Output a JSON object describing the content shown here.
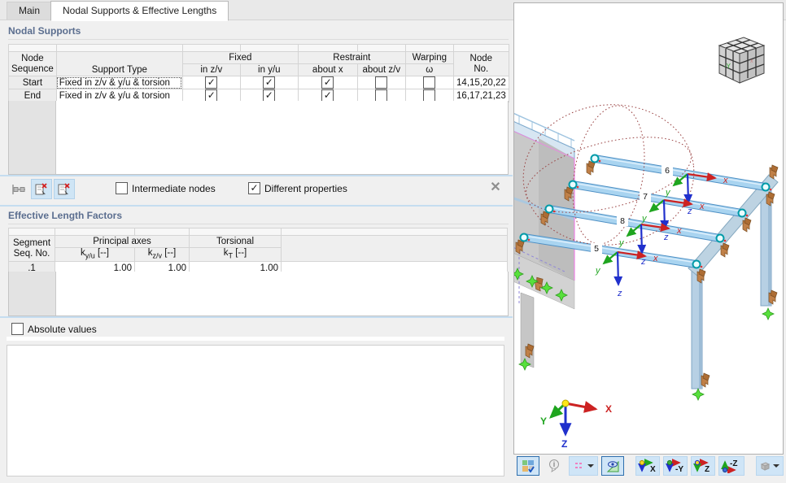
{
  "tabs": {
    "main": "Main",
    "active": "Nodal Supports & Effective Lengths"
  },
  "nodal_supports": {
    "title": "Nodal Supports",
    "col_headers": {
      "node_sequence_l1": "Node",
      "node_sequence_l2": "Sequence",
      "support_type": "Support Type",
      "fixed": "Fixed",
      "in_zv": "in z/v",
      "in_yu": "in y/u",
      "restraint": "Restraint",
      "about_x": "about x",
      "about_zv": "about z/v",
      "warping": "Warping",
      "omega": "ω",
      "node_l1": "Node",
      "node_l2": "No."
    },
    "rows": [
      {
        "seq": "Start",
        "type": "Fixed in z/v & y/u & torsion",
        "in_zv": "✓",
        "in_yu": "✓",
        "about_x": "✓",
        "about_zv": "",
        "omega": "",
        "nodes": "14,15,20,22"
      },
      {
        "seq": "End",
        "type": "Fixed in z/v & y/u & torsion",
        "in_zv": "✓",
        "in_yu": "✓",
        "about_x": "✓",
        "about_zv": "",
        "omega": "",
        "nodes": "16,17,21,23"
      }
    ],
    "intermediate_nodes_label": "Intermediate nodes",
    "intermediate_nodes_check": "",
    "different_properties_label": "Different properties",
    "different_properties_check": "✓",
    "close_x": "✕"
  },
  "effective_lengths": {
    "title": "Effective Length Factors",
    "col_headers": {
      "segment_l1": "Segment",
      "segment_l2": "Seq. No.",
      "principal": "Principal axes",
      "kyu_base": "k",
      "kyu_sub": "y/u",
      "kyu_unit": " [--]",
      "kzv_base": "k",
      "kzv_sub": "z/v",
      "kzv_unit": " [--]",
      "torsional": "Torsional",
      "kt_base": "k",
      "kt_sub": "T",
      "kt_unit": " [--]"
    },
    "rows": [
      {
        "seq": ".1",
        "kyu": "1.00",
        "kzv": "1.00",
        "kt": "1.00"
      }
    ]
  },
  "absolute_values": {
    "label": "Absolute values",
    "check": ""
  },
  "viewport": {
    "nav_cube_label": "-Y",
    "beams": [
      {
        "label": "6"
      },
      {
        "label": "7"
      },
      {
        "label": "8"
      },
      {
        "label": "5"
      }
    ],
    "triad_x": "x",
    "triad_y": "y",
    "triad_z": "z",
    "global_axes": {
      "x": "X",
      "y": "Y",
      "z": "Z"
    },
    "toolbar": {
      "view_x": "X",
      "view_neg_y": "-Y",
      "view_z": "Z",
      "view_neg_z": "-Z"
    }
  },
  "colors": {
    "accent_blue": "#cfe5f7",
    "selected_border": "#2e6fae",
    "splitter": "#c5ddf0",
    "beam_fill": "#a9d4f0",
    "title": "#5b6e8f"
  }
}
